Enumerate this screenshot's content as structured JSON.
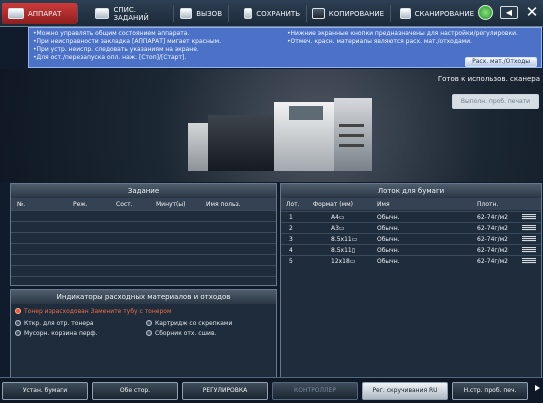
{
  "tabs": [
    {
      "label": "АППАРАТ",
      "icon": "machine-icon",
      "active": true
    },
    {
      "label": "СПИС. ЗАДАНИЙ",
      "icon": "job-list-icon",
      "active": false
    },
    {
      "label": "ВЫЗОВ",
      "icon": "recall-icon",
      "active": false
    },
    {
      "label": "СОХРАНИТЬ",
      "icon": "save-icon",
      "active": false
    },
    {
      "label": "КОПИРОВАНИЕ",
      "icon": "copy-icon",
      "active": false
    },
    {
      "label": "СКАНИРОВАНИЕ",
      "icon": "scan-icon",
      "active": false
    }
  ],
  "banner": {
    "left": "•Можно управлять общим состоянием аппарата.\n•При неисправности закладка [АППАРАТ] мигает красным.\n•При устр. неиспр. следовать указаниям на экране.\n•Для ост./перезапуска опл. наж. [Стоп]/[Старт].",
    "right": "•Нижние экранные кнопки предназначены для настройки/регулировки.\n•Отмеч. красн. материалы являются расх. мат./отходами.",
    "button": "Расх. мат./Отходы"
  },
  "status": {
    "text": "Готов к использов. сканера",
    "preview": "Выполн. проб. печати"
  },
  "job_panel": {
    "title": "Задание",
    "headers": [
      "№.",
      "Реж.",
      "Сост.",
      "Минут(ы)",
      "Имя польз."
    ]
  },
  "tray_panel": {
    "title": "Лоток для бумаги",
    "headers": [
      "Лот.",
      "Формат (мм)",
      "Имя",
      "Плотн."
    ],
    "rows": [
      [
        "1",
        "A4▭",
        "Обычн.",
        "62-74г/м2"
      ],
      [
        "2",
        "A3▭",
        "Обычн.",
        "62-74г/м2"
      ],
      [
        "3",
        "8.5x11▭",
        "Обычн.",
        "62-74г/м2"
      ],
      [
        "4",
        "8.5x11▯",
        "Обычн.",
        "62-74г/м2"
      ],
      [
        "5",
        "12x18▭",
        "Обычн.",
        "62-74г/м2"
      ]
    ]
  },
  "consumables": {
    "title": "Индикаторы расходных материалов и отходов",
    "warning": "Тонер израсходован Замените тубу с тонером",
    "items": [
      "Кткр. для отр. тонера",
      "Картридж со скрепками",
      "Мусорн. корзина перф.",
      "Сборник отх. сшив."
    ]
  },
  "bottom": [
    "Устан. бумаги",
    "Обе стор.",
    "РЕГУЛИРОВКА",
    "КОНТРОЛЛЕР",
    "Рег. скручивания RU",
    "Н.стр. проб. печ."
  ],
  "colors": {
    "active_tab": "#c53030",
    "banner": "#4b72c7",
    "warning": "#ee5b2b"
  }
}
